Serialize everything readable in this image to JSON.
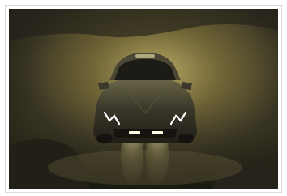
{
  "photo": {
    "subject": "car-photo",
    "palette": {
      "background_dark": "#1e1c12",
      "dust_glow": "#b8a55a",
      "car_body": "#3d3b2f",
      "headlight": "#ffffff",
      "ground_dark": "#2a2920"
    }
  }
}
